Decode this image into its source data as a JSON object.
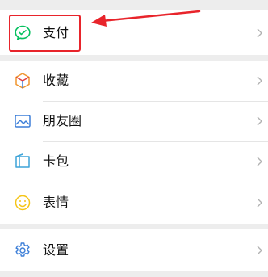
{
  "menu": {
    "pay": {
      "label": "支付",
      "icon": "wechat-pay-icon"
    },
    "items": [
      {
        "label": "收藏",
        "icon": "favorites-cube-icon"
      },
      {
        "label": "朋友圈",
        "icon": "moments-image-icon"
      },
      {
        "label": "卡包",
        "icon": "card-wallet-icon"
      },
      {
        "label": "表情",
        "icon": "smiley-face-icon"
      }
    ],
    "settings": {
      "label": "设置",
      "icon": "gear-icon"
    }
  },
  "colors": {
    "background": "#ededed",
    "card": "#ffffff",
    "highlight": "#e8242b",
    "pay_green": "#07c160",
    "icon_blue": "#3d7fd8",
    "emoji_yellow": "#f5c518"
  }
}
